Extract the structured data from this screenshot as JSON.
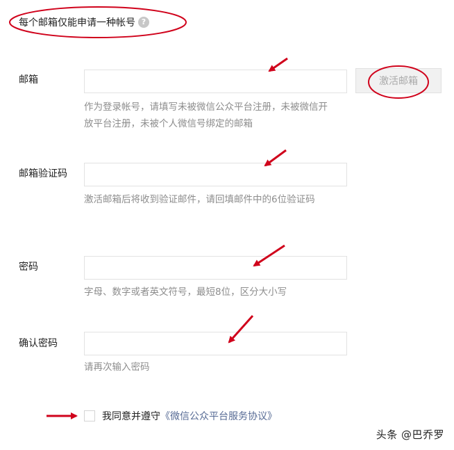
{
  "header_note": {
    "text": "每个邮箱仅能申请一种帐号",
    "help_icon": "?"
  },
  "email": {
    "label": "邮箱",
    "value": "",
    "activate_button": "激活邮箱",
    "hint": "作为登录帐号，请填写未被微信公众平台注册，未被微信开放平台注册，未被个人微信号绑定的邮箱"
  },
  "verify_code": {
    "label": "邮箱验证码",
    "value": "",
    "hint": "激活邮箱后将收到验证邮件，请回填邮件中的6位验证码"
  },
  "password": {
    "label": "密码",
    "value": "",
    "hint": "字母、数字或者英文符号，最短8位，区分大小写"
  },
  "confirm_password": {
    "label": "确认密码",
    "value": "",
    "hint": "请再次输入密码"
  },
  "agreement": {
    "checked": false,
    "prefix": "我同意并遵守",
    "link": "《微信公众平台服务协议》"
  },
  "watermark": "头条 @巴乔罗",
  "colors": {
    "annotation": "#d0021b",
    "link": "#576b95",
    "hint": "#8d8d8d"
  }
}
